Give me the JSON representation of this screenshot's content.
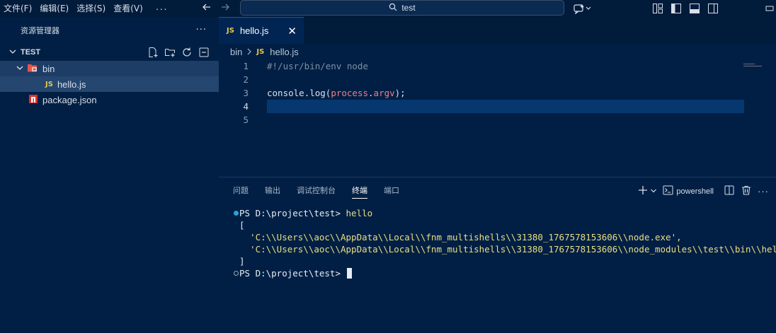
{
  "titlebar": {
    "menus": [
      "文件(F)",
      "编辑(E)",
      "选择(S)",
      "查看(V)"
    ],
    "more": "···",
    "search_text": "test",
    "icons": [
      "arrow-left-icon",
      "arrow-right-icon",
      "search-icon",
      "copilot-icon",
      "layout-icon",
      "toggle-sidebar-icon",
      "toggle-panel-icon",
      "toggle-secondary-sidebar-icon",
      "minimize-icon"
    ]
  },
  "sidebar": {
    "title": "资源管理器",
    "more": "···",
    "section": "TEST",
    "tree": [
      {
        "label": "bin",
        "type": "folder"
      },
      {
        "label": "hello.js",
        "type": "js",
        "badge": "JS"
      },
      {
        "label": "package.json",
        "type": "npm"
      }
    ]
  },
  "editor": {
    "tab": {
      "badge": "JS",
      "name": "hello.js",
      "close": "✕"
    },
    "breadcrumb": {
      "folder": "bin",
      "badge": "JS",
      "file": "hello.js"
    },
    "lines": [
      {
        "n": "1"
      },
      {
        "n": "2"
      },
      {
        "n": "3"
      },
      {
        "n": "4"
      },
      {
        "n": "5"
      }
    ],
    "code": {
      "line1": "#!/usr/bin/env node",
      "l3_console": "console",
      "l3_dot": ".",
      "l3_log": "log",
      "l3_open": "(",
      "l3_process": "process",
      "l3_dot2": ".",
      "l3_argv": "argv",
      "l3_close": ");"
    }
  },
  "panel": {
    "tabs": [
      "问题",
      "输出",
      "调试控制台",
      "终端",
      "端口"
    ],
    "active_tab": "终端",
    "shell_label": "powershell",
    "more": "···"
  },
  "terminal": {
    "prompt1": "PS D:\\project\\test> ",
    "cmd1": "hello",
    "open": "[",
    "out1": "  'C:\\\\Users\\\\aoc\\\\AppData\\\\Local\\\\fnm_multishells\\\\31380_1767578153606\\\\node.exe',",
    "out2": "  'C:\\\\Users\\\\aoc\\\\AppData\\\\Local\\\\fnm_multishells\\\\31380_1767578153606\\\\node_modules\\\\test\\\\bin\\\\hello.js'",
    "close": "]",
    "prompt2": "PS D:\\project\\test> "
  }
}
